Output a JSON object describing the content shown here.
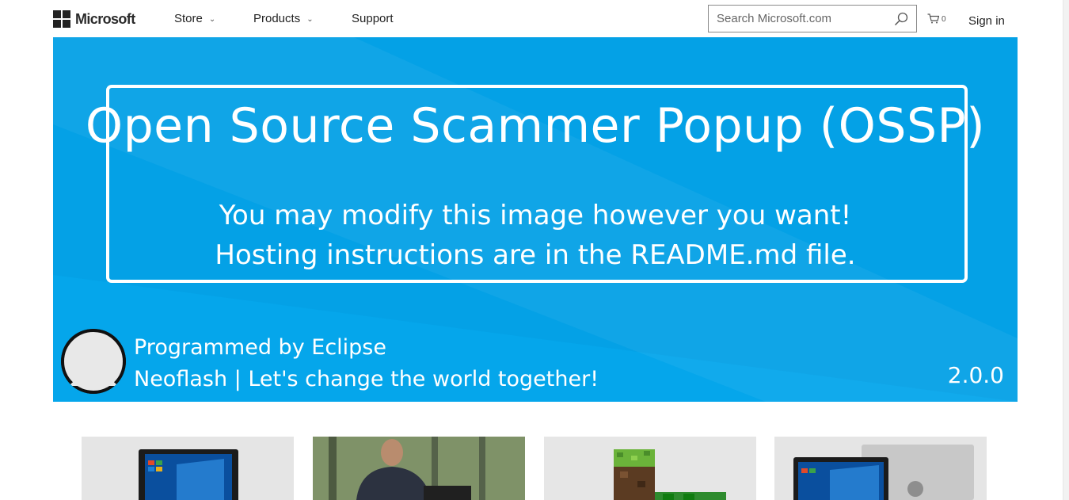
{
  "header": {
    "brand": "Microsoft",
    "nav": [
      {
        "label": "Store",
        "has_dropdown": true
      },
      {
        "label": "Products",
        "has_dropdown": true
      },
      {
        "label": "Support",
        "has_dropdown": false
      }
    ],
    "search_placeholder": "Search Microsoft.com",
    "cart_count": "0",
    "sign_in": "Sign in"
  },
  "hero": {
    "title": "Open Source Scammer Popup (OSSP)",
    "subtitle": "You may modify this image however you want! Hosting instructions are in the README.md file.",
    "credit_line1": "Programmed by Eclipse",
    "credit_line2": "Neoflash | Let's change the world together!",
    "version": "2.0.0",
    "bg_color": "#05a6eb"
  },
  "tiles": [
    {
      "icon": "laptop-icon"
    },
    {
      "icon": "person-photo"
    },
    {
      "icon": "minecraft-console-icon"
    },
    {
      "icon": "laptop-icon"
    }
  ]
}
